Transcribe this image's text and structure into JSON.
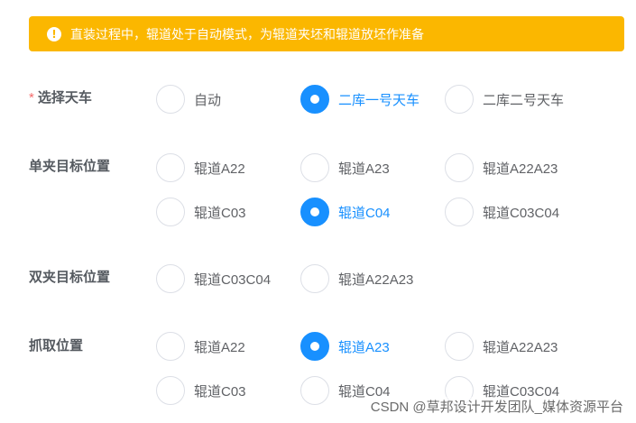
{
  "alert": {
    "icon": "warning-circle-icon",
    "text": "直装过程中，辊道处于自动模式，为辊道夹坯和辊道放坯作准备"
  },
  "sections": {
    "crane": {
      "required_mark": "*",
      "label": "选择天车",
      "options": [
        "自动",
        "二库一号天车",
        "二库二号天车"
      ],
      "selected": "二库一号天车"
    },
    "single": {
      "label": "单夹目标位置",
      "options": [
        "辊道A22",
        "辊道A23",
        "辊道A22A23",
        "辊道C03",
        "辊道C04",
        "辊道C03C04"
      ],
      "selected": "辊道C04"
    },
    "double": {
      "label": "双夹目标位置",
      "options": [
        "辊道C03C04",
        "辊道A22A23"
      ],
      "selected": ""
    },
    "grab": {
      "label": "抓取位置",
      "options": [
        "辊道A22",
        "辊道A23",
        "辊道A22A23",
        "辊道C03",
        "辊道C04",
        "辊道C03C04"
      ],
      "selected": "辊道A23"
    }
  },
  "watermark": "CSDN @草邦设计开发团队_媒体资源平台",
  "colors": {
    "alert_bg": "#fbb700",
    "primary": "#1890ff",
    "required": "#f56c6c"
  }
}
